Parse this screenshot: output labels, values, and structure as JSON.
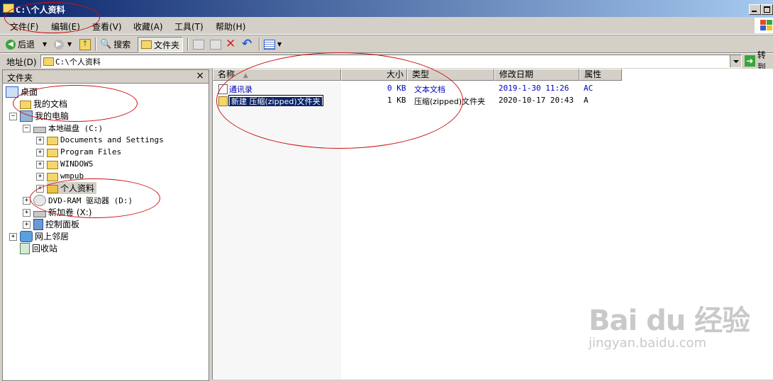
{
  "window": {
    "title": "C:\\个人资料"
  },
  "menubar": {
    "items": [
      "文件(F)",
      "编辑(E)",
      "查看(V)",
      "收藏(A)",
      "工具(T)",
      "帮助(H)"
    ]
  },
  "toolbar": {
    "back_label": "后退",
    "search_label": "搜索",
    "folders_label": "文件夹"
  },
  "address": {
    "label": "地址(D)",
    "value": "C:\\个人资料",
    "go_label": "转到"
  },
  "folders_pane": {
    "title": "文件夹",
    "close": "×",
    "tree": [
      {
        "label": "桌面",
        "icon": "desktop-icon"
      },
      {
        "label": "我的文档",
        "icon": "my-documents-icon"
      },
      {
        "label": "我的电脑",
        "icon": "my-computer-icon"
      },
      {
        "label": "本地磁盘 (C:)",
        "icon": "hard-drive-icon"
      },
      {
        "label": "Documents and Settings",
        "icon": "folder-icon"
      },
      {
        "label": "Program Files",
        "icon": "folder-icon"
      },
      {
        "label": "WINDOWS",
        "icon": "folder-icon"
      },
      {
        "label": "wmpub",
        "icon": "folder-icon"
      },
      {
        "label": "个人资料",
        "icon": "open-folder-icon"
      },
      {
        "label": "DVD-RAM 驱动器 (D:)",
        "icon": "dvd-drive-icon"
      },
      {
        "label": "新加卷 (X:)",
        "icon": "hard-drive-icon"
      },
      {
        "label": "控制面板",
        "icon": "control-panel-icon"
      },
      {
        "label": "网上邻居",
        "icon": "network-icon"
      },
      {
        "label": "回收站",
        "icon": "recycle-bin-icon"
      }
    ]
  },
  "file_list": {
    "columns": [
      "名称",
      "大小",
      "类型",
      "修改日期",
      "属性"
    ],
    "rows": [
      {
        "name": "通讯录",
        "size": "0 KB",
        "type": "文本文档",
        "modified": "2019-1-30 11:26",
        "attrs": "AC"
      },
      {
        "name": "新建 压缩(zipped)文件夹",
        "size": "1 KB",
        "type": "压缩(zipped)文件夹",
        "modified": "2020-10-17 20:43",
        "attrs": "A"
      }
    ]
  },
  "watermark": {
    "brand": "Bai du 经验",
    "url": "jingyan.baidu.com"
  }
}
